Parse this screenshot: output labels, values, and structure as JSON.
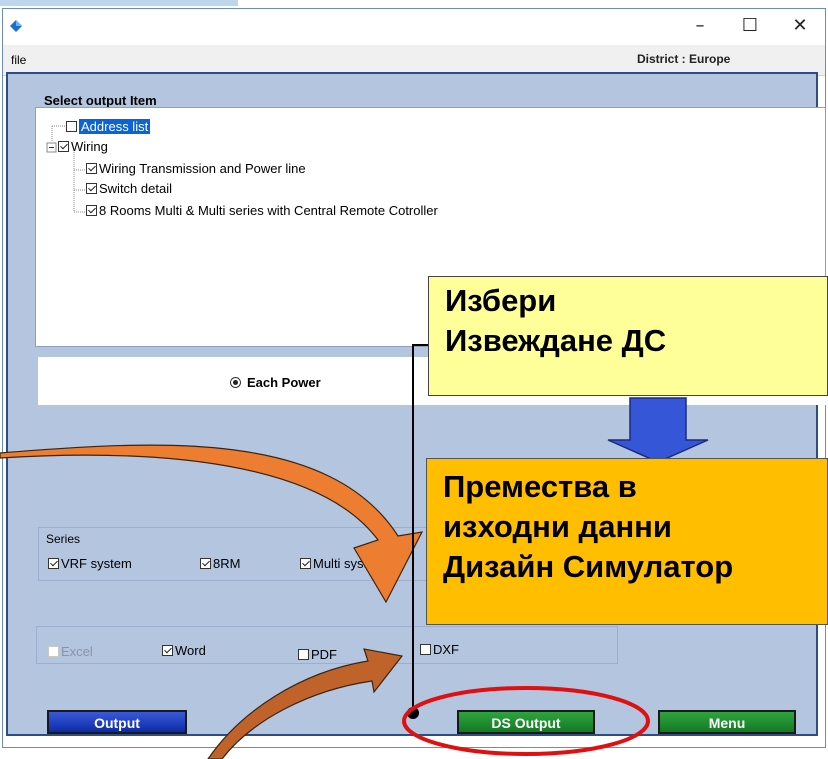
{
  "window": {
    "title": "",
    "controls": [
      "–",
      "☐",
      "✕"
    ]
  },
  "menu": {
    "file": "file",
    "district": "District : Europe"
  },
  "output_items": {
    "heading": "Select output Item",
    "items": [
      {
        "label": "Address list",
        "checked": false,
        "selected": true
      },
      {
        "label": "Wiring",
        "checked": true
      },
      {
        "label": "Wiring Transmission and Power line",
        "checked": true
      },
      {
        "label": "Switch detail",
        "checked": true
      },
      {
        "label": "8 Rooms Multi & Multi series with Central Remote Cotroller",
        "checked": true
      }
    ],
    "tree_expander": "−"
  },
  "power_option": {
    "label": "Each Power",
    "selected": true
  },
  "series": {
    "heading": "Series",
    "options": [
      {
        "label": "VRF system",
        "checked": true
      },
      {
        "label": "8RM",
        "checked": true
      },
      {
        "label": "Multi system",
        "checked": true
      }
    ]
  },
  "formats": [
    {
      "label": "Excel",
      "checked": false,
      "enabled": false
    },
    {
      "label": "Word",
      "checked": true
    },
    {
      "label": "PDF",
      "checked": false
    },
    {
      "label": "DXF",
      "checked": false
    }
  ],
  "buttons": {
    "output": "Output",
    "ds_output": "DS Output",
    "menu": "Menu"
  },
  "callouts": {
    "select_line1": "Избери",
    "select_line2": "Извеждане ДС",
    "moves_line1": "Премества в",
    "moves_line2": "изходни данни",
    "moves_line3": "Дизайн Симулатор"
  },
  "colors": {
    "client_bg": "#b3c5df",
    "highlight": "#0a64d8",
    "callout_yellow": "#ffff99",
    "callout_orange": "#ffbf00",
    "ellipse_red": "#e11010"
  }
}
